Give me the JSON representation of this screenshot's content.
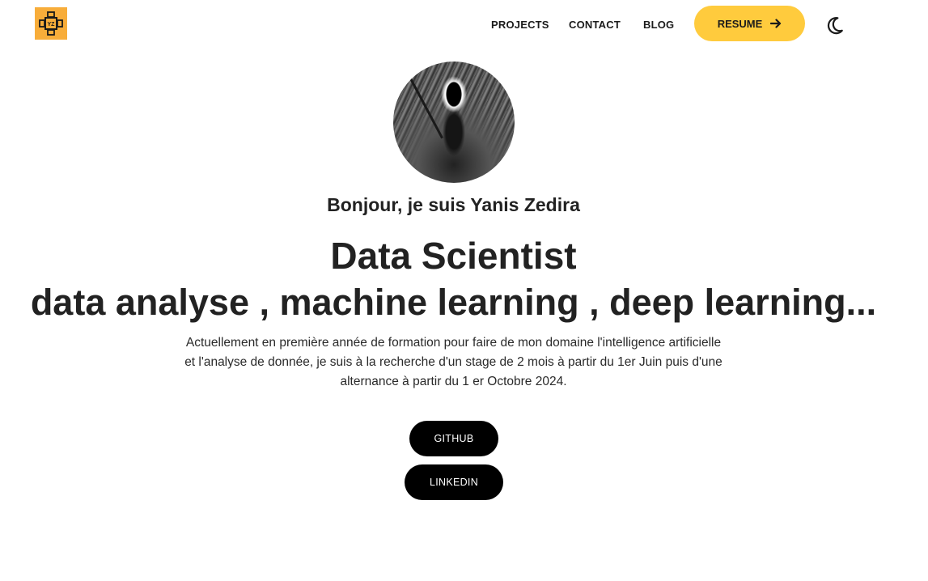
{
  "logo": {
    "text": "YZ",
    "color": "#f8ad3a"
  },
  "nav": {
    "links": [
      "PROJECTS",
      "CONTACT",
      "BLOG"
    ],
    "resume_label": "RESUME",
    "resume_color": "#ffcb3d",
    "theme_icon": "moon-icon"
  },
  "hero": {
    "avatar_alt": "avatar",
    "greeting": "Bonjour, je suis Yanis Zedira",
    "role": "Data Scientist",
    "skills": "data analyse , machine learning , deep learning...",
    "intro": "Actuellement en première année de formation pour faire de mon domaine l'intelligence artificielle et l'analyse de donnée, je suis à la recherche d'un stage de 2 mois à partir du 1er Juin puis d'une alternance à partir du 1 er Octobre 2024.",
    "buttons": [
      "GITHUB",
      "LINKEDIN"
    ]
  }
}
